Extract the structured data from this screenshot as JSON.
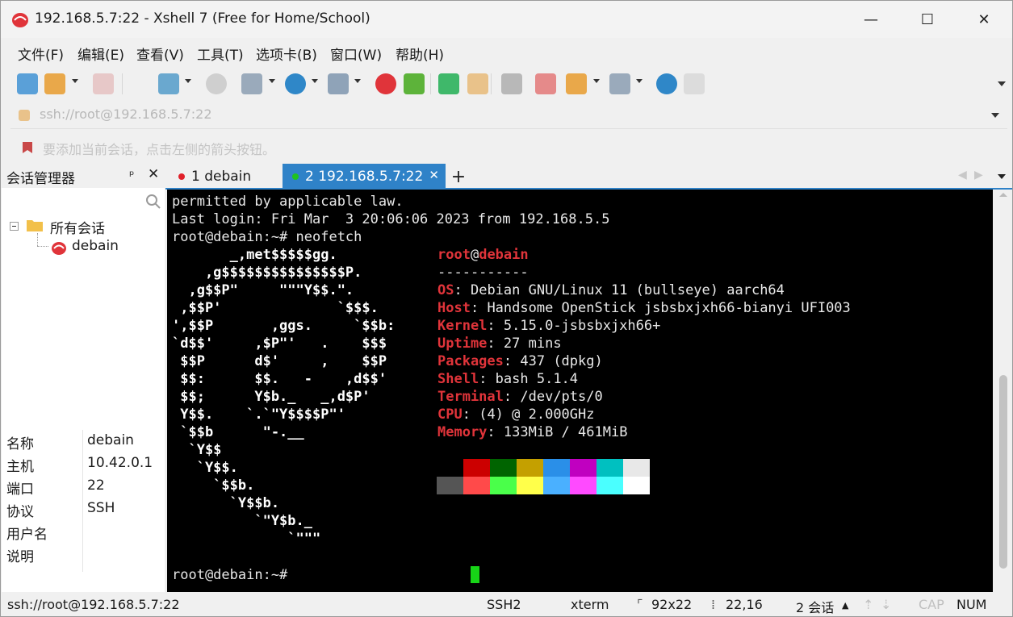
{
  "window": {
    "title": "192.168.5.7:22 - Xshell 7 (Free for Home/School)",
    "controls": {
      "minimize": "—",
      "maximize": "☐",
      "close": "✕"
    }
  },
  "menu": [
    "文件(F)",
    "编辑(E)",
    "查看(V)",
    "工具(T)",
    "选项卡(B)",
    "窗口(W)",
    "帮助(H)"
  ],
  "toolbar": {
    "icons": [
      "new-session-icon",
      "open-folder-icon",
      "disconnect-icon",
      "reconnect-icon",
      "properties-icon",
      "find-icon",
      "font-icon",
      "globe-icon",
      "compose-icon",
      "xshell-icon",
      "xftp-icon",
      "fullscreen-icon",
      "lock-icon",
      "keyboard-icon",
      "highlight-icon",
      "script-icon",
      "layout-icon",
      "help-icon"
    ]
  },
  "address": {
    "value": "ssh://root@192.168.5.7:22"
  },
  "hint": {
    "text": "要添加当前会话，点击左侧的箭头按钮。"
  },
  "session_panel": {
    "title": "会话管理器",
    "pin": "ᵖ",
    "close": "✕",
    "tree_root": "所有会话",
    "tree_child": "debain",
    "properties": [
      {
        "key": "名称",
        "value": "debain"
      },
      {
        "key": "主机",
        "value": "10.42.0.1"
      },
      {
        "key": "端口",
        "value": "22"
      },
      {
        "key": "协议",
        "value": "SSH"
      },
      {
        "key": "用户名",
        "value": ""
      },
      {
        "key": "说明",
        "value": ""
      }
    ]
  },
  "tabs": [
    {
      "label": "1 debain",
      "dot_color": "#e0202a",
      "active": false
    },
    {
      "label": "2 192.168.5.7:22",
      "dot_color": "#1fc21f",
      "active": true
    }
  ],
  "tab_add": "+",
  "terminal": {
    "lines": [
      "permitted by applicable law.",
      "Last login: Fri Mar  3 20:06:06 2023 from 192.168.5.5",
      "root@debain:~# neofetch"
    ],
    "logo": [
      "       _,met$$$$$gg.",
      "    ,g$$$$$$$$$$$$$$$P.",
      "  ,g$$P\"     \"\"\"Y$$.\".",
      " ,$$P'              `$$$.",
      "',$$P       ,ggs.     `$$b:",
      "`d$$'     ,$P\"'   .    $$$",
      " $$P      d$'     ,    $$P",
      " $$:      $$.   -    ,d$$'",
      " $$;      Y$b._   _,d$P'",
      " Y$$.    `.`\"Y$$$$P\"'",
      " `$$b      \"-.__",
      "  `Y$$",
      "   `Y$$.",
      "     `$$b.",
      "       `Y$$b.",
      "          `\"Y$b._",
      "              `\"\"\""
    ],
    "user_host": {
      "user": "root",
      "at": "@",
      "host": "debain"
    },
    "separator": "-----------",
    "info": [
      {
        "key": "OS",
        "value": "Debian GNU/Linux 11 (bullseye) aarch64"
      },
      {
        "key": "Host",
        "value": "Handsome OpenStick jsbsbxjxh66-bianyi UFI003"
      },
      {
        "key": "Kernel",
        "value": "5.15.0-jsbsbxjxh66+"
      },
      {
        "key": "Uptime",
        "value": "27 mins"
      },
      {
        "key": "Packages",
        "value": "437 (dpkg)"
      },
      {
        "key": "Shell",
        "value": "bash 5.1.4"
      },
      {
        "key": "Terminal",
        "value": "/dev/pts/0"
      },
      {
        "key": "CPU",
        "value": "(4) @ 2.000GHz"
      },
      {
        "key": "Memory",
        "value": "133MiB / 461MiB"
      }
    ],
    "palette_top": [
      "#000000",
      "#cc0000",
      "#006400",
      "#c4a000",
      "#2a8fe8",
      "#c000c0",
      "#00c0c0",
      "#e8e8e8"
    ],
    "palette_bottom": [
      "#555555",
      "#ff4a4a",
      "#4aff4a",
      "#ffff4a",
      "#4ab0ff",
      "#ff4aff",
      "#4affff",
      "#ffffff"
    ],
    "prompt": "root@debain:~# ",
    "cursor_color": "#17d417"
  },
  "status": {
    "connection": "ssh://root@192.168.5.7:22",
    "protocol": "SSH2",
    "term": "xterm",
    "size": "92x22",
    "position": "22,16",
    "sessions": "2 会话",
    "caps": "CAP",
    "num": "NUM"
  },
  "colors": {
    "accent": "#2f82c8",
    "terminal_bg": "#000000",
    "label_red": "#e0343a"
  }
}
